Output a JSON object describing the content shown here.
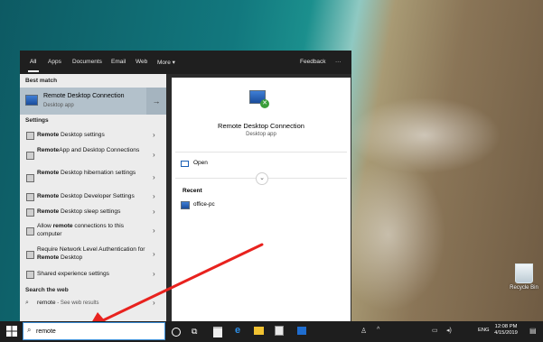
{
  "search_panel": {
    "tabs": [
      "All",
      "Apps",
      "Documents",
      "Email",
      "Web",
      "More ▾"
    ],
    "feedback": "Feedback",
    "more_menu": "···",
    "best_match_header": "Best match",
    "best_match": {
      "title": "Remote Desktop Connection",
      "subtitle": "Desktop app"
    },
    "settings_header": "Settings",
    "search_web_header": "Search the web",
    "web_result": {
      "query": "remote",
      "hint": " - See web results"
    }
  },
  "preview": {
    "title": "Remote Desktop Connection",
    "subtitle": "Desktop app",
    "open_label": "Open",
    "recent_header": "Recent",
    "recent_items": [
      "office-pc"
    ]
  },
  "taskbar": {
    "search_value": "remote",
    "language": "ENG",
    "time": "12:08 PM",
    "date": "4/15/2019"
  },
  "desktop": {
    "recycle_bin_label": "Recycle Bin"
  },
  "colors": {
    "arrow": "#e8221e",
    "highlight": "#b3c1cb"
  }
}
